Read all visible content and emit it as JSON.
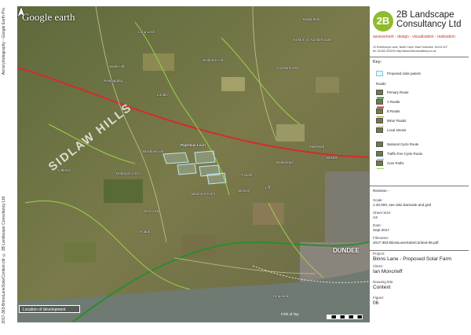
{
  "side": {
    "copyright": "2017-363-BinnsLaneSolarContext.cdr © 2B Landscape Consultancy Ltd",
    "aerial": "Aerial photography - Google Earth Pro"
  },
  "map": {
    "provider": "Google earth",
    "range_label": "SIDLAW HILLS",
    "city_label": "DUNDEE",
    "location_box": "Location of development",
    "water_label": "Firth of Tay",
    "places": [
      "Ballindean",
      "Long Loch",
      "Kirkton of Auchterhouse",
      "Auchterhouse",
      "Ballo Hill",
      "Newbigging",
      "Smithton Hill",
      "Lundie",
      "Blacklaw Hill",
      "Pipertain Loch",
      "Littleton",
      "Redmyre Loch",
      "Fowlis",
      "Benvie",
      "Blairmuir Farm",
      "Bankhead",
      "Dron Hill",
      "Knapp",
      "Kingoodie",
      "Muirhead",
      "Birkhill",
      "Liff"
    ]
  },
  "panel": {
    "brand_mark": "2B",
    "brand_name_line1": "2B Landscape",
    "brand_name_line2": "Consultancy Ltd",
    "brand_tagline": "assessment - design - visualisation - realisation",
    "brand_address": "12 Everthorpe Lane, North Cave, East Yorkshire, HU15 2LF",
    "brand_phone": "tel: 01430 423234",
    "brand_web": "http://www.2blconsultancy.co.uk",
    "key_title": "Key:",
    "key_solar": "Proposed solar panels",
    "roads_heading": "Roads",
    "roads": [
      "Primary Route",
      "A Roads",
      "B Roads",
      "Minor Roads",
      "Local streets"
    ],
    "paths": [
      "National Cycle Route",
      "Traffic-free Cycle Route",
      "Core Paths"
    ],
    "revision_label": "Revision:",
    "revision_value": "-",
    "scale_label": "Scale:",
    "scale_value": "1:40,000, see also barscale and grid",
    "sheet_label": "Sheet Size:",
    "sheet_value": "A3",
    "date_label": "Date:",
    "date_value": "Sept 2017",
    "filename_label": "Filename:",
    "filename_value": "2017-363-BinnsLaneSolarContext-06.pdf",
    "project_label": "Project:",
    "project_value": "Binns Lane - Proposed Solar Farm",
    "client_label": "Client:",
    "client_value": "Ian Moncrieff",
    "drawing_label": "Drawing title:",
    "drawing_value": "Context",
    "figure_label": "Figure:",
    "figure_value": "06"
  },
  "colors": {
    "primary_route": "#2e8b2e",
    "a_road": "#d62b2b",
    "core_paths": "#9bd14a",
    "solar": "#bfe8f0",
    "brand": "#8fbc2c"
  }
}
